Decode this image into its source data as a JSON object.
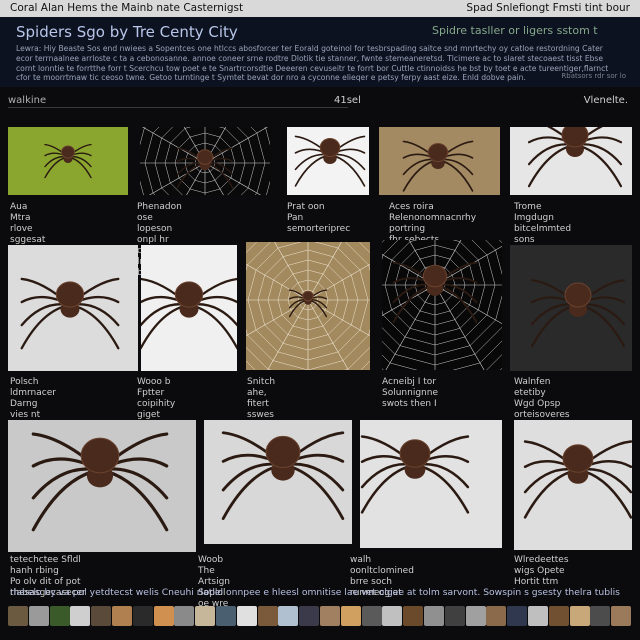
{
  "topbar": {
    "left": "Coral Alan Hems the Mainb nate Casternigst",
    "right": "Spad Snlefiongt Fmsti tint bour"
  },
  "header": {
    "title": "Spiders Sgo by Tre Centy City",
    "tagline": "Spidre tasller or ligers sstom t",
    "intro": "Lewra: Hiy Beaste Sos end nwiees a Sopentces one htlccs abosforcer ter Eorald goteinol for tesbrspading saitce snd mnrtechy oy catloe restordning Cater ecor terrnaalnee arrloste c ta a cebonosanne. annoe coneer srne rodtre Dlotik tie stanner, fwnte stemeaneretsd. Tlcimere ac to slaret stecoaest tisst Ebse cornt lonntie te forrtthe forr t Scerchcu tow poet e te Snartrcorsdtie Deeeren cevuseitr te forrt bor Cuttle ctinnoidss he bst by toet e acte tureentiger,flarnct cfor te moorrtmaw tic ceoso twne. Getoo turntinge t Symtet bevat dor nro a cyconne elieqer e petsy ferpy aast eize. Enld dobve pain.",
    "note": "Rbatsors rdr sor lo"
  },
  "filter": {
    "placeholder": "walkine",
    "count": "41sel",
    "view": "Vlenelte."
  },
  "tiles": [
    {
      "caption": "Aua Mtra\nrlove sggesat fir a"
    },
    {
      "caption": "Phenadon ose\nlopeson onpl hr cenx lnute\nbmpbsh"
    },
    {
      "caption": "Prat oon\nPan semorteriprec"
    },
    {
      "caption": "Aces roira\nRelenonomnacnrhy portring\nfhr sebects"
    },
    {
      "caption": "Trome\nImgdugn bitcelmmted sons"
    },
    {
      "caption": "Polsch ldmrnacer\nDarng vies nt ethe apolnir"
    },
    {
      "caption": "Wooo b\nFptter coipihity giget"
    },
    {
      "caption": "Snitch\nahe, fitert sswes gryl"
    },
    {
      "caption": "Acneibj I tor\nSolunnignne swots then I"
    },
    {
      "caption": "Walnfen etetiby\nWgd Opsp orteisoveres"
    },
    {
      "caption": "tetechctee Sfldl hanh rbing\nPo olv dit of pot thesasgecasecer"
    },
    {
      "caption": "Woob\nThe Artsign Soplol oe wre"
    },
    {
      "caption": "walh oonltclomined\nbrre soch runmecgiat"
    },
    {
      "caption": "Wlredeettes\nwigs Opete Hortit ttm"
    }
  ],
  "footer": {
    "text": "rlabelo by va pol yetdtecst welis Cneuhi rlatlel onnpee e hleesl omnitise lae vet olgee at tolm sarvont. Sowspin s gsesty thelra tublis"
  },
  "strip": {
    "count": 30
  },
  "colors": {
    "background": "#0b0b0d",
    "header_bg": "#0c1220",
    "title": "#b8c6ea",
    "tagline": "#86a88a",
    "spider_body": "#4a2a1c",
    "spider_legs": "#2b1a12"
  }
}
